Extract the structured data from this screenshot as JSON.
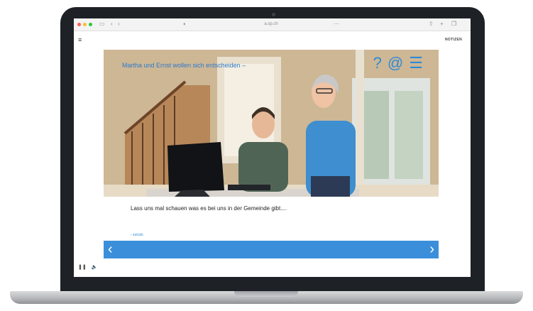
{
  "browser": {
    "url": "a.sp.ch",
    "icons": [
      "sidebar-icon",
      "chevron-left-icon",
      "chevron-right-icon",
      "shield-icon",
      "share-icon",
      "new-tab-icon",
      "tabs-icon"
    ]
  },
  "header": {
    "menu_glyph": "≡",
    "notes_label": "NOTIZEN"
  },
  "scene": {
    "title": "Martha und Ernst wollen sich entscheiden –",
    "icon_help": "?",
    "icon_at": "@",
    "icon_menu": "☰",
    "colors": {
      "accent": "#2f8ad6",
      "nav": "#3b8fda",
      "title": "#2e7ac8"
    }
  },
  "dialogue": {
    "text": "Lass uns mal schauen was es bei uns in der Gemeinde gibt...."
  },
  "navigation": {
    "back_link": "‹ zurück",
    "prev_glyph": "‹",
    "next_glyph": "›"
  },
  "playback": {
    "pause_glyph": "❚❚",
    "volume_glyph": "🔈"
  }
}
